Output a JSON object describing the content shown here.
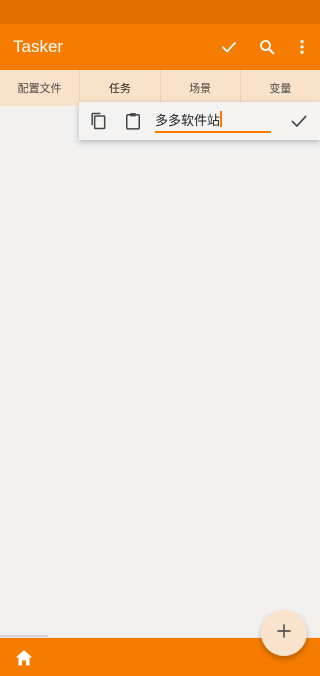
{
  "app_bar": {
    "title": "Tasker",
    "actions": [
      "check-icon",
      "search-icon",
      "more-vert-icon"
    ]
  },
  "tabs": [
    {
      "label": "配置文件",
      "active": false
    },
    {
      "label": "任务",
      "active": true
    },
    {
      "label": "场景",
      "active": false
    },
    {
      "label": "变量",
      "active": false
    }
  ],
  "text_popup": {
    "input_value": "多多软件站",
    "icons": [
      "copy-icon",
      "paste-icon",
      "confirm-check-icon"
    ]
  },
  "fab": {
    "icon": "add-icon"
  },
  "bottom_bar": {
    "icon": "home-icon"
  },
  "colors": {
    "accent": "#f57c00",
    "status_bar": "#e56f00",
    "tab_bg": "#f9e2c9",
    "content_bg": "#f2f1f0",
    "fab_bg": "#f9e3cc"
  }
}
